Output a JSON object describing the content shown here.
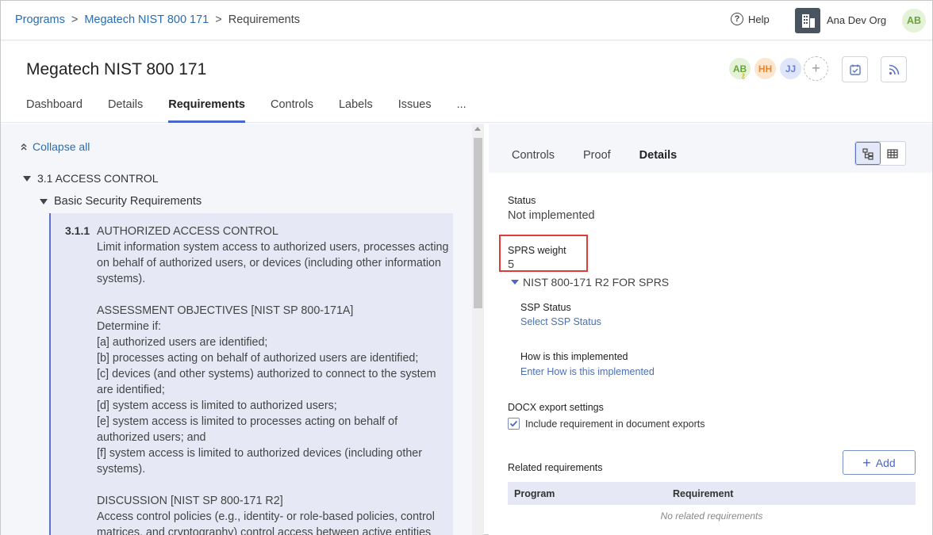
{
  "breadcrumb": {
    "items": [
      "Programs",
      "Megatech NIST 800 171"
    ],
    "current": "Requirements",
    "separator": ">"
  },
  "topbar": {
    "help_label": "Help",
    "org_name": "Ana Dev Org",
    "user_initials": "AB"
  },
  "header": {
    "title": "Megatech NIST 800 171",
    "members": [
      "AB",
      "HH",
      "JJ"
    ],
    "add_member": "+",
    "tabs": [
      "Dashboard",
      "Details",
      "Requirements",
      "Controls",
      "Labels",
      "Issues",
      "..."
    ],
    "active_tab": "Requirements"
  },
  "tree": {
    "collapse_all": "Collapse all",
    "section": "3.1 ACCESS CONTROL",
    "subsection": "Basic Security Requirements",
    "requirement": {
      "number": "3.1.1",
      "lines": [
        "AUTHORIZED ACCESS CONTROL",
        "Limit information system access to authorized users, processes acting on behalf of authorized users, or devices (including other information systems).",
        "",
        "ASSESSMENT OBJECTIVES [NIST SP 800-171A]",
        "Determine if:",
        "[a] authorized users are identified;",
        "[b] processes acting on behalf of authorized users are identified;",
        "[c] devices (and other systems) authorized to connect to the system are identified;",
        "[d] system access is limited to authorized users;",
        "[e] system access is limited to processes acting on behalf of authorized users; and",
        "[f] system access is limited to authorized devices (including other systems).",
        "",
        "DISCUSSION [NIST SP 800-171 R2]",
        "Access control policies (e.g., identity- or role-based policies, control matrices, and cryptography) control access between active entities"
      ]
    }
  },
  "details": {
    "tabs": [
      "Controls",
      "Proof",
      "Details"
    ],
    "active_tab": "Details",
    "status_label": "Status",
    "status_value": "Not implemented",
    "sprs_label": "SPRS weight",
    "sprs_value": "5",
    "nist_group": "NIST 800-171 R2 FOR SPRS",
    "ssp_status_label": "SSP Status",
    "ssp_status_link": "Select SSP Status",
    "how_label": "How is this implemented",
    "how_link": "Enter How is this implemented",
    "docx_label": "DOCX export settings",
    "docx_checkbox": "Include requirement in document exports",
    "docx_checked": true,
    "related_label": "Related requirements",
    "add_button": "Add",
    "table_columns": [
      "Program",
      "Requirement"
    ],
    "table_empty": "No related requirements"
  },
  "colors": {
    "accent": "#4a66c8",
    "link": "#2b6cb0",
    "highlight_border": "#e03b3b",
    "card_bg": "#e6e9f5"
  }
}
